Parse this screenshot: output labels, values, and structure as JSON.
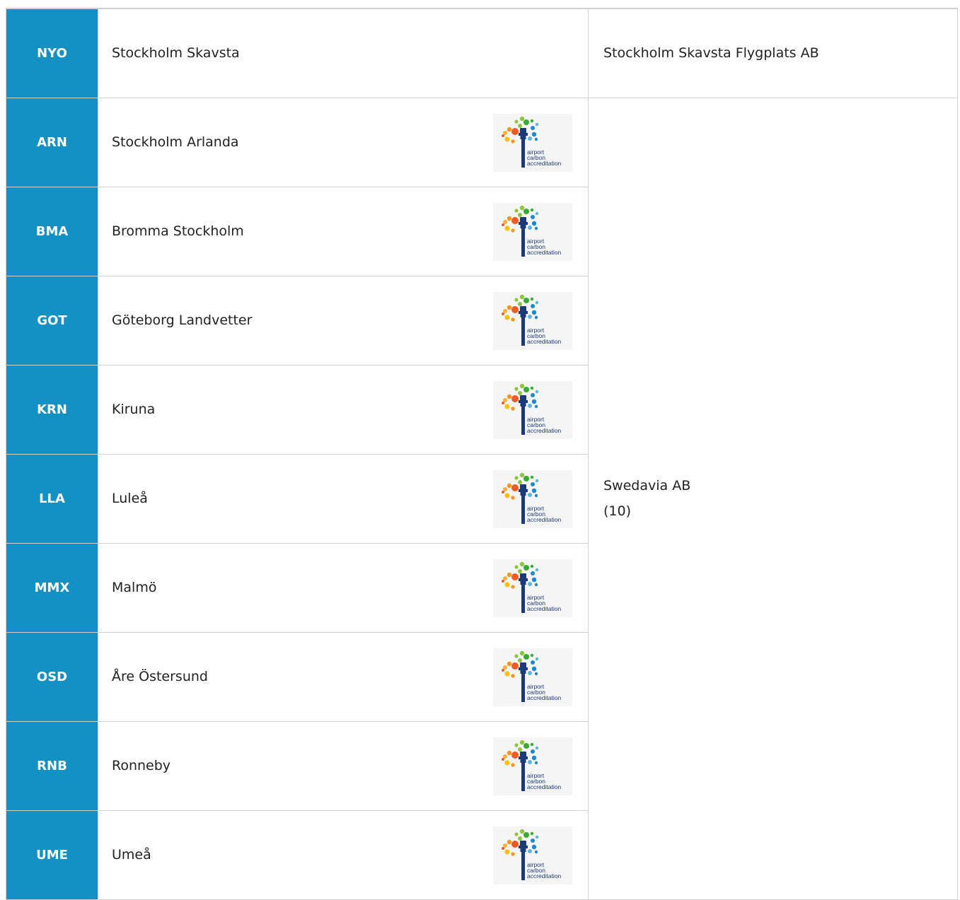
{
  "table": {
    "rows": [
      {
        "code": "NYO",
        "name": "Stockholm Skavsta",
        "has_badge": false
      },
      {
        "code": "ARN",
        "name": "Stockholm Arlanda",
        "has_badge": true
      },
      {
        "code": "BMA",
        "name": "Bromma Stockholm",
        "has_badge": true
      },
      {
        "code": "GOT",
        "name": "Göteborg Landvetter",
        "has_badge": true
      },
      {
        "code": "KRN",
        "name": "Kiruna",
        "has_badge": true
      },
      {
        "code": "LLA",
        "name": "Luleå",
        "has_badge": true
      },
      {
        "code": "MMX",
        "name": "Malmö",
        "has_badge": true
      },
      {
        "code": "OSD",
        "name": "Åre Östersund",
        "has_badge": true
      },
      {
        "code": "RNB",
        "name": "Ronneby",
        "has_badge": true
      },
      {
        "code": "UME",
        "name": "Umeå",
        "has_badge": true
      }
    ],
    "operators": [
      {
        "name": "Stockholm Skavsta Flygplats AB",
        "count": ""
      },
      {
        "name": "Swedavia AB",
        "count": "(10)"
      }
    ]
  },
  "badge": {
    "line1": "airport",
    "line2": "carbon",
    "line3": "accreditation",
    "icon": "airport-carbon-accreditation-logo"
  },
  "colors": {
    "code_cell_bg": "#1390c4",
    "code_text": "#ffffff",
    "border": "#d0d0d0",
    "badge_navy": "#1b3a7a"
  }
}
